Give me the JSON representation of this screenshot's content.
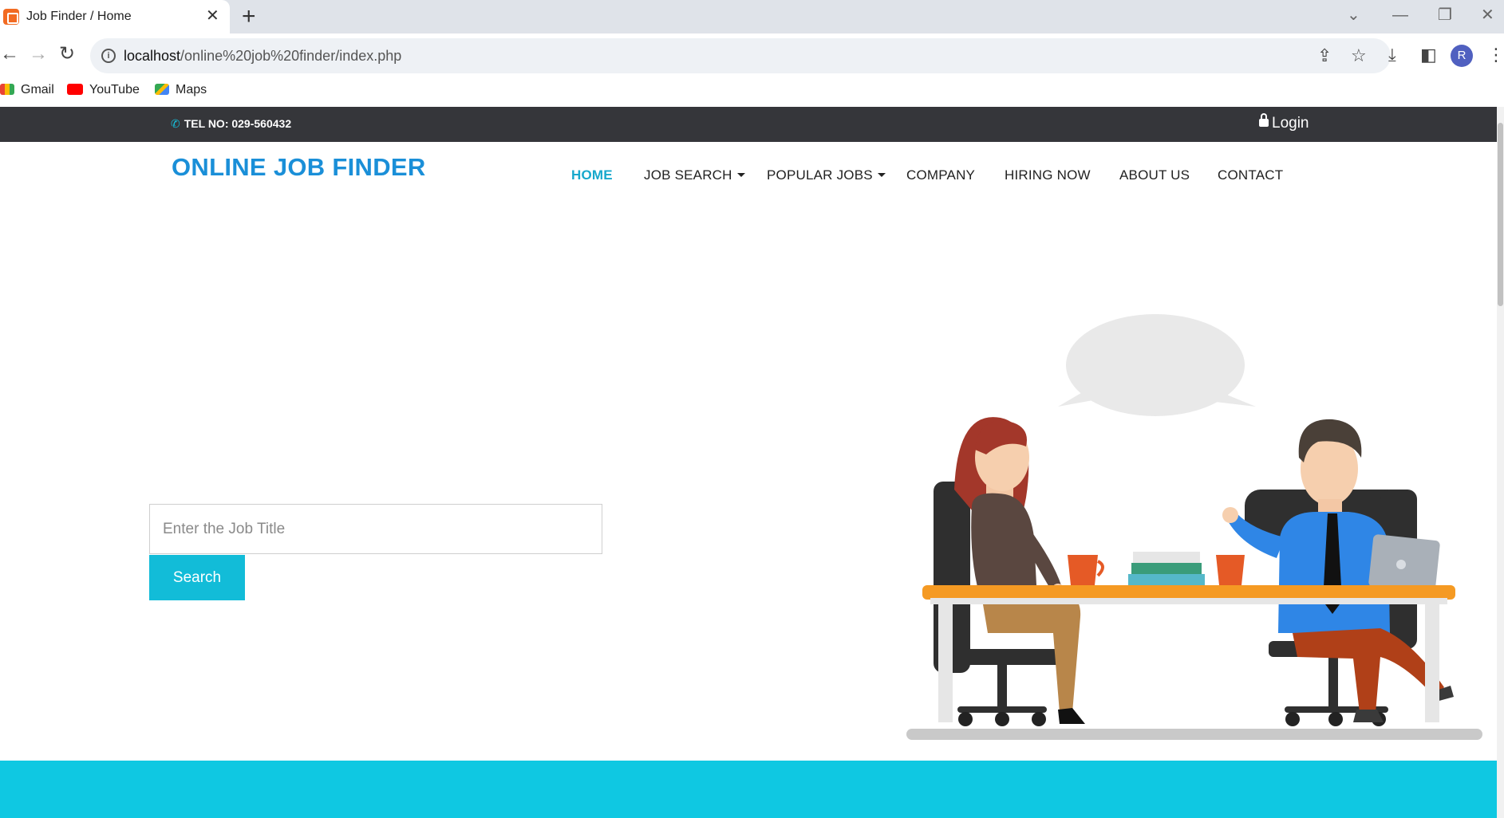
{
  "browser": {
    "tab_title": "Job Finder / Home",
    "url_host": "localhost",
    "url_path": "/online%20job%20finder/index.php",
    "profile_initial": "R",
    "bookmarks": [
      {
        "label": "Gmail",
        "icon": "gmail-icon"
      },
      {
        "label": "YouTube",
        "icon": "youtube-icon"
      },
      {
        "label": "Maps",
        "icon": "maps-icon"
      }
    ]
  },
  "topbar": {
    "tel": "TEL NO: 029-560432",
    "login": "Login"
  },
  "header": {
    "brand": "ONLINE JOB FINDER",
    "nav": [
      {
        "label": "HOME",
        "active": true,
        "dropdown": false
      },
      {
        "label": "JOB SEARCH",
        "active": false,
        "dropdown": true
      },
      {
        "label": "POPULAR JOBS",
        "active": false,
        "dropdown": true
      },
      {
        "label": "COMPANY",
        "active": false,
        "dropdown": false
      },
      {
        "label": "HIRING NOW",
        "active": false,
        "dropdown": false
      },
      {
        "label": "ABOUT US",
        "active": false,
        "dropdown": false
      },
      {
        "label": "CONTACT",
        "active": false,
        "dropdown": false
      }
    ]
  },
  "hero": {
    "search_placeholder": "Enter the Job Title",
    "search_value": "",
    "search_button": "Search"
  },
  "colors": {
    "brand": "#1a8fd8",
    "accent": "#12bcd8",
    "topbar": "#35363a",
    "footer_band": "#0fc8e2"
  }
}
